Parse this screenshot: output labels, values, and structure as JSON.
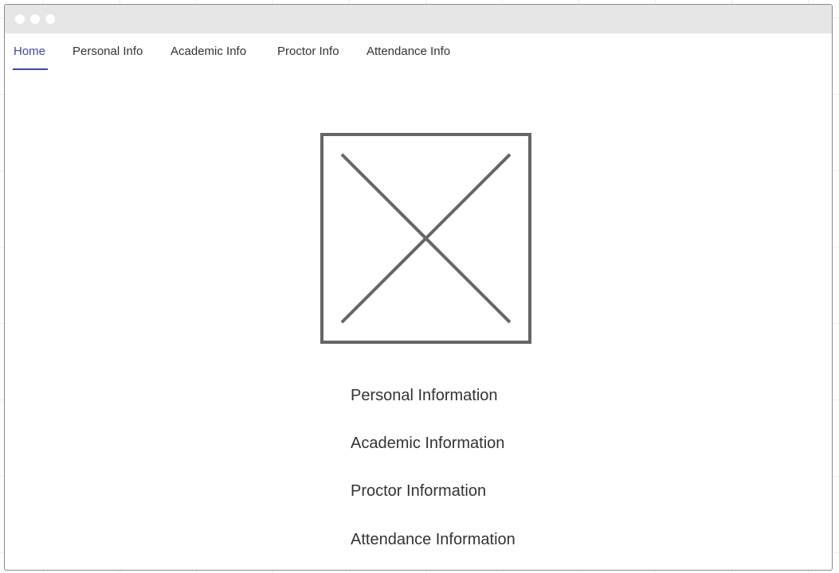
{
  "nav": {
    "tabs": [
      {
        "label": "Home"
      },
      {
        "label": "Personal Info"
      },
      {
        "label": "Academic Info"
      },
      {
        "label": "Proctor Info"
      },
      {
        "label": "Attendance Info"
      }
    ],
    "active_tab": "Home"
  },
  "main": {
    "image": {
      "icon": "image-placeholder-icon"
    },
    "links": [
      {
        "label": "Personal Information"
      },
      {
        "label": "Academic Information"
      },
      {
        "label": "Proctor Information"
      },
      {
        "label": "Attendance Information"
      }
    ]
  },
  "colors": {
    "accent": "#3f48a8",
    "text": "#333333",
    "placeholder_stroke": "#666666",
    "titlebar": "#e6e6e6"
  }
}
